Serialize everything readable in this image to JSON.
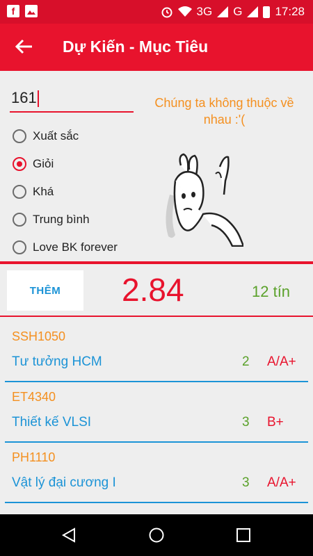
{
  "status_bar": {
    "signal_3g": "3G",
    "signal_g": "G",
    "time": "17:28"
  },
  "app_bar": {
    "title": "Dự Kiến - Mục Tiêu"
  },
  "target_input": {
    "value": "161"
  },
  "message": "Chúng ta không thuộc về nhau :'(",
  "options": [
    {
      "label": "Xuất sắc",
      "selected": false
    },
    {
      "label": "Giỏi",
      "selected": true
    },
    {
      "label": "Khá",
      "selected": false
    },
    {
      "label": "Trung bình",
      "selected": false
    },
    {
      "label": "Love BK forever",
      "selected": false
    }
  ],
  "summary": {
    "add_label": "THÊM",
    "gpa": "2.84",
    "credits": "12 tín"
  },
  "courses": [
    {
      "code": "SSH1050",
      "name": "Tư tưởng HCM",
      "credits": "2",
      "grade": "A/A+"
    },
    {
      "code": "ET4340",
      "name": "Thiết kế VLSI",
      "credits": "3",
      "grade": "B+"
    },
    {
      "code": "PH1110",
      "name": "Vật lý đại cương I",
      "credits": "3",
      "grade": "A/A+"
    }
  ],
  "colors": {
    "status_bar": "#d70f2a",
    "app_bar": "#e8132d",
    "accent_orange": "#f49020",
    "accent_blue": "#1b93d6",
    "accent_green": "#5aa12a"
  }
}
